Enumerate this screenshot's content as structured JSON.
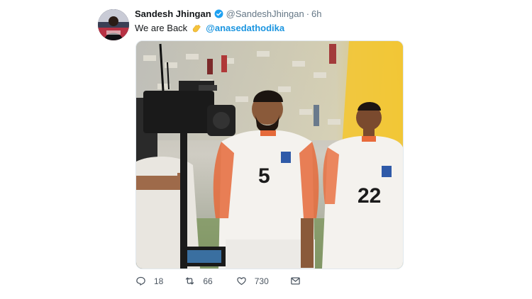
{
  "tweet": {
    "author_name": "Sandesh Jhingan",
    "author_handle": "@SandeshJhingan",
    "separator": "·",
    "time": "6h",
    "text": "We are Back",
    "mention": "@anasedathodika",
    "emoji_icon": "clapping-hands-icon"
  },
  "actions": {
    "replies": "18",
    "retweets": "66",
    "likes": "730"
  },
  "media": {
    "jersey_numbers": [
      "5",
      "22"
    ],
    "description_icon": "photo"
  },
  "colors": {
    "link": "#1b95e0",
    "secondary_text": "#657786",
    "verified_badge": "#1da1f2"
  }
}
